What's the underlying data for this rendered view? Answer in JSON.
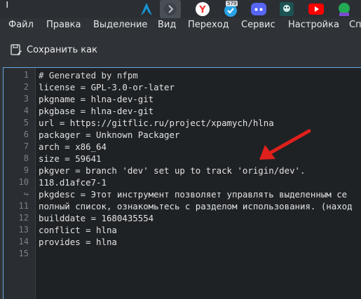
{
  "taskbar": {
    "items": [
      {
        "icon": "arch-logo-icon",
        "color": "#1793d1"
      },
      {
        "icon": "chevron-right-icon",
        "color": "#8a9199"
      },
      {
        "icon": "yandex-browser-icon",
        "color": "#ff3333"
      },
      {
        "icon": "messenger-icon",
        "color": "#2aa3e6",
        "badge": "579"
      },
      {
        "icon": "discord-icon",
        "color": "#5865f2"
      },
      {
        "icon": "app-icon",
        "color": "#2a7a7a"
      },
      {
        "icon": "youtube-icon",
        "color": "#ff0000"
      },
      {
        "icon": "green-app-icon",
        "color": "#22aa55"
      }
    ]
  },
  "menubar": {
    "items": [
      "Файл",
      "Правка",
      "Выделение",
      "Вид",
      "Переход",
      "Сервис",
      "Настройка",
      "Сп"
    ]
  },
  "toolbar": {
    "save_as_label": "Сохранить как"
  },
  "editor": {
    "line_numbers": [
      "1",
      "2",
      "3",
      "4",
      "5",
      "6",
      "7",
      "8",
      "9",
      "10",
      "↪",
      "11",
      "12",
      "13",
      "14",
      "15"
    ],
    "lines": [
      "# Generated by nfpm",
      "license = GPL-3.0-or-later",
      "pkgname = hlna-dev-git",
      "pkgbase = hlna-dev-git",
      "url = https://gitflic.ru/project/xpamych/hlna",
      "packager = Unknown Packager",
      "arch = x86_64",
      "size = 59641",
      "pkgver = branch 'dev' set up to track 'origin/dev'.",
      "118.d1afce7-1",
      "pkgdesc = Этот инструмент позволяет управлять выделенным се",
      "полный список, ознакомьтесь с разделом использования. (наход",
      "builddate = 1680435554",
      "conflict = hlna",
      "provides = hlna",
      ""
    ]
  },
  "colors": {
    "arrow": "#e0201c",
    "editor_bg": "#1f2225",
    "focus_border": "#6aa6dc"
  }
}
